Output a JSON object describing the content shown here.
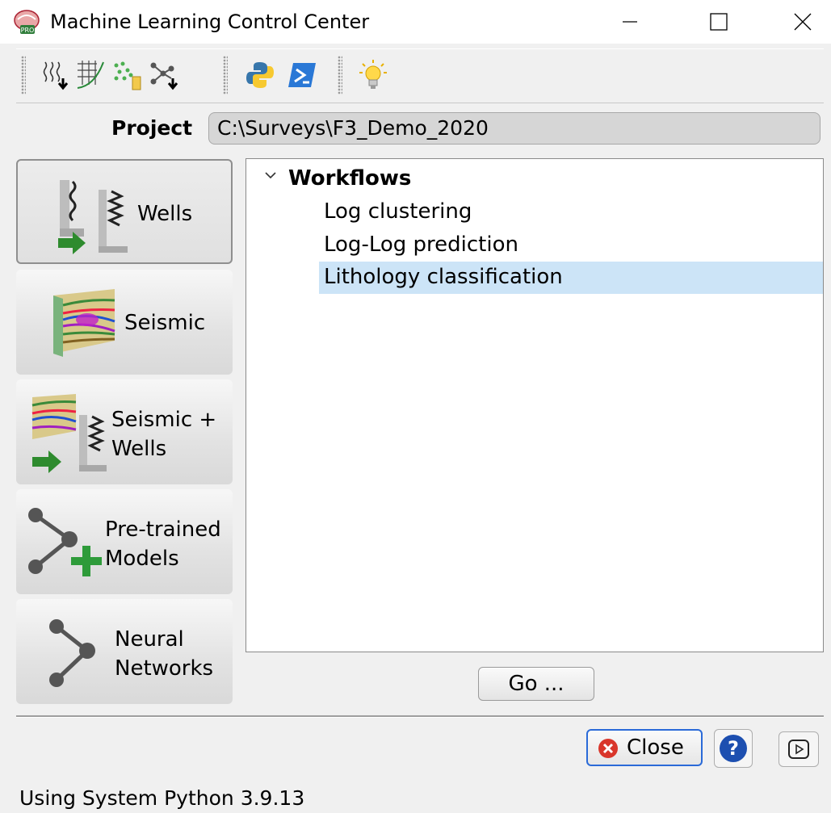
{
  "window": {
    "title": "Machine Learning Control Center",
    "app_icon": "mlcc-pro-icon",
    "controls": [
      "minimize-icon",
      "maximize-icon",
      "close-icon"
    ]
  },
  "toolbar": {
    "buttons": [
      {
        "icon": "log-import-icon"
      },
      {
        "icon": "crossplot-icon"
      },
      {
        "icon": "scatter-data-icon"
      },
      {
        "icon": "network-data-icon"
      },
      {
        "icon": "python-icon"
      },
      {
        "icon": "powershell-icon"
      },
      {
        "icon": "lightbulb-icon"
      }
    ]
  },
  "project": {
    "label": "Project",
    "path": "C:\\Surveys\\F3_Demo_2020"
  },
  "categories": [
    {
      "label_line1": "Wells",
      "label_line2": "",
      "icon": "wells-icon",
      "active": true
    },
    {
      "label_line1": "Seismic",
      "label_line2": "",
      "icon": "seismic-icon",
      "active": false
    },
    {
      "label_line1": "Seismic +",
      "label_line2": "Wells",
      "icon": "seismic-wells-icon",
      "active": false
    },
    {
      "label_line1": "Pre-trained",
      "label_line2": "Models",
      "icon": "pretrained-models-icon",
      "active": false
    },
    {
      "label_line1": "Neural",
      "label_line2": "Networks",
      "icon": "neural-network-icon",
      "active": false
    }
  ],
  "tree": {
    "root": "Workflows",
    "items": [
      "Log clustering",
      "Log-Log prediction",
      "Lithology classification"
    ],
    "selected_index": 2
  },
  "buttons": {
    "go": "Go ...",
    "close": "Close"
  },
  "status": "Using System Python 3.9.13",
  "colors": {
    "selection": "#cce4f7",
    "close_border": "#2a6ad8",
    "close_icon": "#d9362b",
    "help": "#1d4fb0",
    "arrow_green": "#2e8b2e"
  }
}
